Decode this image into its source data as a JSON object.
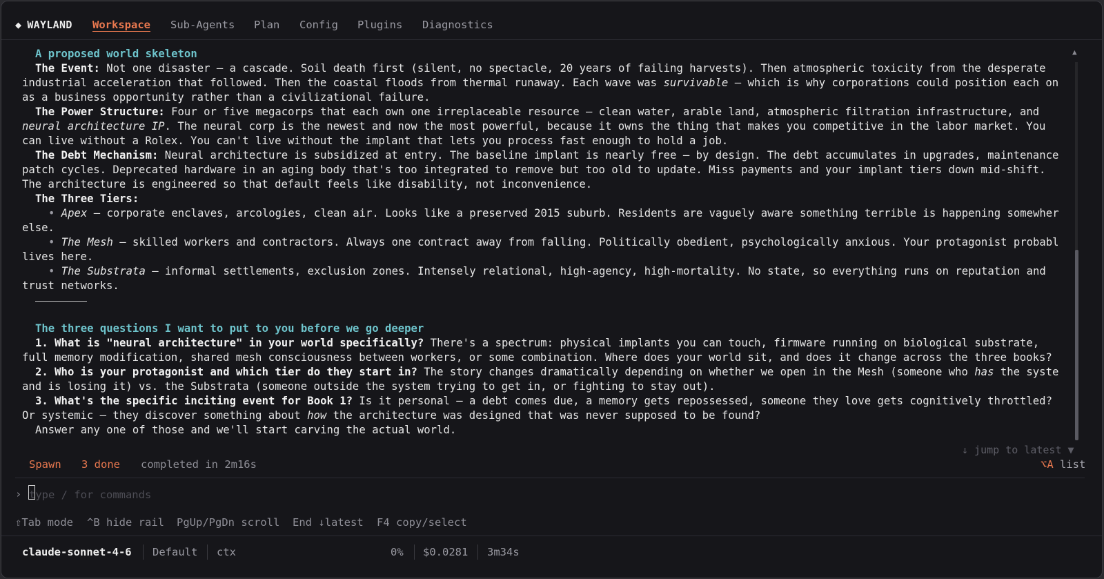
{
  "brand": {
    "glyph": "◆",
    "name": "WAYLAND"
  },
  "tabs": [
    {
      "label": "Workspace"
    },
    {
      "label": "Sub-Agents"
    },
    {
      "label": "Plan"
    },
    {
      "label": "Config"
    },
    {
      "label": "Plugins"
    },
    {
      "label": "Diagnostics"
    }
  ],
  "doc": {
    "heading1": "A proposed world skeleton",
    "event": {
      "label": "The Event:",
      "t1": " Not one disaster — a cascade. Soil death first (silent, no spectacle, 20 years of failing harvests). Then atmospheric toxicity from the desperate",
      "t2": "industrial acceleration that followed. Then the coastal floods from thermal runaway. Each wave was ",
      "t2i": "survivable",
      "t2b": " — which is why corporations could position each on",
      "t3": "as a business opportunity rather than a civilizational failure."
    },
    "power": {
      "label": "The Power Structure:",
      "t1": " Four or five megacorps that each own one irreplaceable resource — clean water, arable land, atmospheric filtration infrastructure, and",
      "t2i": "neural architecture IP",
      "t2": ". The neural corp is the newest and now the most powerful, because it owns the thing that makes you competitive in the labor market. You",
      "t3": "can live without a Rolex. You can't live without the implant that lets you process fast enough to hold a job."
    },
    "debt": {
      "label": "The Debt Mechanism:",
      "t1": " Neural architecture is subsidized at entry. The baseline implant is nearly free — by design. The debt accumulates in upgrades, maintenance",
      "t2": "patch cycles. Deprecated hardware in an aging body that's too integrated to remove but too old to update. Miss payments and your implant tiers down mid-shift.",
      "t3": "The architecture is engineered so that default feels like disability, not inconvenience."
    },
    "tiers_label": "The Three Tiers:",
    "tiers": [
      {
        "bullet": "•",
        "name": "Apex",
        "t1": " — corporate enclaves, arcologies, clean air. Looks like a preserved 2015 suburb. Residents are vaguely aware something terrible is happening somewher",
        "t2": "else."
      },
      {
        "bullet": "•",
        "name": "The Mesh",
        "t1": " — skilled workers and contractors. Always one contract away from falling. Politically obedient, psychologically anxious. Your protagonist probabl",
        "t2": "lives here."
      },
      {
        "bullet": "•",
        "name": "The Substrata",
        "t1": " — informal settlements, exclusion zones. Intensely relational, high-agency, high-mortality. No state, so everything runs on reputation and",
        "t2": "trust networks."
      }
    ],
    "heading2": "The three questions I want to put to you before we go deeper",
    "q1": {
      "label": "1. What is \"neural architecture\" in your world specifically?",
      "t1": " There's a spectrum: physical implants you can touch, firmware running on biological substrate,",
      "t2": "full memory modification, shared mesh consciousness between workers, or some combination. Where does your world sit, and does it change across the three books?"
    },
    "q2": {
      "label": "2. Who is your protagonist and which tier do they start in?",
      "t1": " The story changes dramatically depending on whether we open in the Mesh (someone who ",
      "t1i": "has",
      "t1b": " the syste",
      "t2": "and is losing it) vs. the Substrata (someone outside the system trying to get in, or fighting to stay out)."
    },
    "q3": {
      "label": "3. What's the specific inciting event for Book 1?",
      "t1": " Is it personal — a debt comes due, a memory gets repossessed, someone they love gets cognitively throttled?",
      "t2a": "Or systemic — they discover something about ",
      "t2i": "how",
      "t2b": " the architecture was designed that was never supposed to be found?"
    },
    "closing": "Answer any one of those and we'll start carving the actual world."
  },
  "jump_latest": "↓ jump to latest ▼",
  "scroll_up": "▲",
  "status": {
    "spawn": "Spawn",
    "done": "3 done",
    "completed": "completed in 2m16s"
  },
  "shortcut": {
    "key": "⌥A",
    "label": " list"
  },
  "input": {
    "prompt": "›",
    "placeholder": "type / for commands"
  },
  "hints": [
    {
      "text": "⇧Tab mode"
    },
    {
      "text": "^B hide rail"
    },
    {
      "text": "PgUp/PgDn scroll"
    },
    {
      "text": "End ↓latest"
    },
    {
      "text": "F4 copy/select"
    }
  ],
  "footer": {
    "model": "claude-sonnet-4-6",
    "mode": "Default",
    "ctx": "ctx",
    "pct": "0%",
    "cost": "$0.0281",
    "time": "3m34s"
  },
  "colors": {
    "accent": "#e8784f",
    "heading": "#6ec4cc",
    "bg": "#16161a"
  }
}
